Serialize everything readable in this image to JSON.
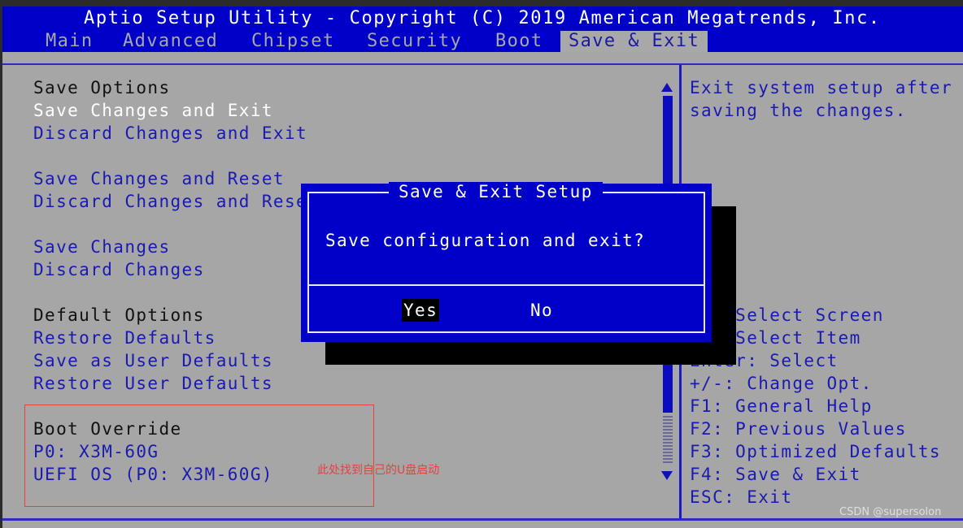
{
  "header": {
    "title": "Aptio Setup Utility - Copyright (C) 2019 American Megatrends, Inc.",
    "tabs": [
      {
        "label": "Main",
        "active": false
      },
      {
        "label": "Advanced",
        "active": false
      },
      {
        "label": "Chipset",
        "active": false
      },
      {
        "label": "Security",
        "active": false
      },
      {
        "label": "Boot",
        "active": false
      },
      {
        "label": "Save & Exit",
        "active": true
      }
    ]
  },
  "menu": {
    "save_options_header": "Save Options",
    "save_changes_and_exit": "Save Changes and Exit",
    "discard_changes_and_exit": "Discard Changes and Exit",
    "save_changes_and_reset": "Save Changes and Reset",
    "discard_changes_and_reset": "Discard Changes and Reset",
    "save_changes": "Save Changes",
    "discard_changes": "Discard Changes",
    "default_options_header": "Default Options",
    "restore_defaults": "Restore Defaults",
    "save_as_user_defaults": "Save as User Defaults",
    "restore_user_defaults": "Restore User Defaults",
    "boot_override_header": "Boot Override",
    "boot_devices": [
      "P0: X3M-60G",
      "UEFI OS (P0: X3M-60G)"
    ]
  },
  "help": {
    "description_lines": [
      "Exit system setup after",
      "saving the changes."
    ],
    "keys": [
      "→←: Select Screen",
      "↑↓: Select Item",
      "Enter: Select",
      "+/-: Change Opt.",
      "F1: General Help",
      "F2: Previous Values",
      "F3: Optimized Defaults",
      "F4: Save & Exit",
      "ESC: Exit"
    ]
  },
  "dialog": {
    "title": "Save & Exit Setup",
    "message": "Save configuration and exit?",
    "yes_label": "Yes",
    "no_label": "No",
    "selected": "Yes"
  },
  "annotation": {
    "text": "此处找到自己的U盘启动",
    "color": "#e84040"
  },
  "watermark": "CSDN @supersolon",
  "colors": {
    "bios_blue": "#0000c8",
    "panel_gray": "#a6a6a6",
    "item_blue": "#1a1ab0"
  }
}
